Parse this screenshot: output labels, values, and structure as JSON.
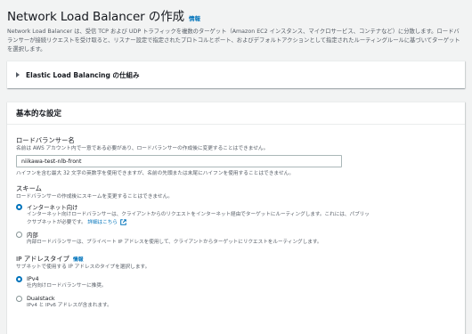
{
  "header": {
    "title": "Network Load Balancer の作成",
    "info": "情報",
    "description": "Network Load Balancer は、受信 TCP および UDP トラフィックを複数のターゲット（Amazon EC2 インスタンス、マイクロサービス、コンテナなど）に分散します。ロードバランサーが接続リクエストを受け取ると、リスナー設定で指定されたプロトコルとポート、およびデフォルトアクションとして指定されたルーティングルールに基づいてターゲットを選択します。"
  },
  "expander": {
    "label": "Elastic Load Balancing の仕組み"
  },
  "basic": {
    "title": "基本的な設定",
    "name": {
      "label": "ロードバランサー名",
      "description": "名前は AWS アカウント内で一意である必要があり、ロードバランサーの作成後に変更することはできません。",
      "value": "niikawa-test-nlb-front",
      "constraint": "ハイフンを含む最大 32 文字の英数字を使用できますが、名前の先頭または末尾にハイフンを使用することはできません。"
    },
    "scheme": {
      "label": "スキーム",
      "description": "ロードバランサーの作成後にスキームを変更することはできません。",
      "options": [
        {
          "label": "インターネット向け",
          "description": "インターネット向けロードバランサーは、クライアントからのリクエストをインターネット経由でターゲットにルーティングします。これには、パブリックサブネットが必要です。",
          "link": "詳細はこちら",
          "checked": true
        },
        {
          "label": "内部",
          "description": "内部ロードバランサーは、プライベート IP アドレスを使用して、クライアントからターゲットにリクエストをルーティングします。",
          "checked": false
        }
      ]
    },
    "ip": {
      "label": "IP アドレスタイプ",
      "info": "情報",
      "description": "サブネットで使用する IP アドレスのタイプを選択します。",
      "options": [
        {
          "label": "IPv4",
          "description": "社内向けロードバランサーに推奨。",
          "checked": true
        },
        {
          "label": "Dualstack",
          "description": "IPv4 と IPv6 アドレスが含まれます。",
          "checked": false
        }
      ]
    }
  },
  "colors": {
    "accent": "#0073bb",
    "text": "#16191f",
    "muted": "#545b64",
    "background": "#f2f3f3"
  }
}
